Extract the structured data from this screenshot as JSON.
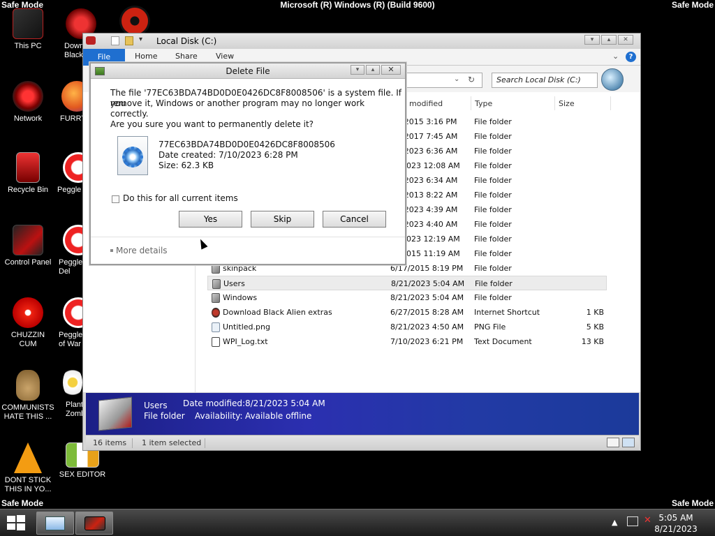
{
  "screen": {
    "safe_mode_label": "Safe Mode",
    "build_text": "Microsoft (R) Windows (R) (Build 9600)"
  },
  "desktop_icons": [
    {
      "label": "This PC",
      "icon": "this-pc-icon"
    },
    {
      "label": "Down\nBlack",
      "icon": "download-icon"
    },
    {
      "label": "",
      "icon": "radiation-icon"
    },
    {
      "label": "Network",
      "icon": "network-icon"
    },
    {
      "label": "FURRY",
      "icon": "firefox-icon"
    },
    {
      "label": "Recycle Bin",
      "icon": "recycle-bin-icon"
    },
    {
      "label": "Peggle",
      "icon": "peggle-icon"
    },
    {
      "label": "Control Panel",
      "icon": "control-panel-icon"
    },
    {
      "label": "Peggle\nDel",
      "icon": "peggle-icon"
    },
    {
      "label": "CHUZZIN\nCUM",
      "icon": "chuzzle-icon"
    },
    {
      "label": "Peggle\nof War",
      "icon": "peggle-icon"
    },
    {
      "label": "COMMUNISTS\nHATE THIS ...",
      "icon": "money-bag-icon"
    },
    {
      "label": "Plant\nZomb",
      "icon": "flower-icon"
    },
    {
      "label": "DONT STICK\nTHIS IN YO...",
      "icon": "vlc-cone-icon"
    },
    {
      "label": "SEX EDITOR",
      "icon": "hxd-icon"
    }
  ],
  "explorer": {
    "title": "Local Disk (C:)",
    "ribbon_tabs": [
      "File",
      "Home",
      "Share",
      "View"
    ],
    "search_placeholder": "Search Local Disk (C:)",
    "columns": {
      "date": "modified",
      "type": "Type",
      "size": "Size"
    },
    "rows": [
      {
        "name": "",
        "date": "/2015 3:16 PM",
        "type": "File folder",
        "size": "",
        "icon": "folder"
      },
      {
        "name": "",
        "date": "/2017 7:45 AM",
        "type": "File folder",
        "size": "",
        "icon": "folder"
      },
      {
        "name": "",
        "date": "/2023 6:36 AM",
        "type": "File folder",
        "size": "",
        "icon": "folder"
      },
      {
        "name": "",
        "date": "2023 12:08 AM",
        "type": "File folder",
        "size": "",
        "icon": "folder"
      },
      {
        "name": "",
        "date": "/2023 6:34 AM",
        "type": "File folder",
        "size": "",
        "icon": "folder"
      },
      {
        "name": "",
        "date": "/2013 8:22 AM",
        "type": "File folder",
        "size": "",
        "icon": "folder"
      },
      {
        "name": "",
        "date": "/2023 4:39 AM",
        "type": "File folder",
        "size": "",
        "icon": "folder"
      },
      {
        "name": "",
        "date": "/2023 4:40 AM",
        "type": "File folder",
        "size": "",
        "icon": "folder"
      },
      {
        "name": "",
        "date": "2023 12:19 AM",
        "type": "File folder",
        "size": "",
        "icon": "folder"
      },
      {
        "name": "",
        "date": "2015 11:19 AM",
        "type": "File folder",
        "size": "",
        "icon": "folder"
      },
      {
        "name": "skinpack",
        "date": "6/17/2015 8:19 PM",
        "type": "File folder",
        "size": "",
        "icon": "folder"
      },
      {
        "name": "Users",
        "date": "8/21/2023 5:04 AM",
        "type": "File folder",
        "size": "",
        "icon": "folder",
        "selected": true
      },
      {
        "name": "Windows",
        "date": "8/21/2023 5:04 AM",
        "type": "File folder",
        "size": "",
        "icon": "folder"
      },
      {
        "name": "Download Black Alien extras",
        "date": "6/27/2015 8:28 AM",
        "type": "Internet Shortcut",
        "size": "1 KB",
        "icon": "shortcut"
      },
      {
        "name": "Untitled.png",
        "date": "8/21/2023 4:50 AM",
        "type": "PNG File",
        "size": "5 KB",
        "icon": "png"
      },
      {
        "name": "WPI_Log.txt",
        "date": "7/10/2023 6:21 PM",
        "type": "Text Document",
        "size": "13 KB",
        "icon": "txt"
      }
    ],
    "details_pane": {
      "name": "Users",
      "kind": "File folder",
      "date_label": "Date modified:",
      "date_value": "8/21/2023 5:04 AM",
      "avail_label": "Availability:",
      "avail_value": "Available offline"
    },
    "status": {
      "count": "16 items",
      "selection": "1 item selected"
    }
  },
  "dialog": {
    "title": "Delete File",
    "message_line1": "The file '77EC63BDA74BD0D0E0426DC8F8008506' is a system file. If you",
    "message_line2": "remove it, Windows or another program may no longer work correctly.",
    "question": "Are you sure you want to permanently delete it?",
    "file_name": "77EC63BDA74BD0D0E0426DC8F8008506",
    "date_created": "Date created: 7/10/2023 6:28 PM",
    "size": "Size: 62.3 KB",
    "checkbox_label": "Do this for all current items",
    "yes": "Yes",
    "skip": "Skip",
    "cancel": "Cancel",
    "more_details": "More details"
  },
  "taskbar": {
    "time": "5:05 AM",
    "date": "8/21/2023"
  }
}
